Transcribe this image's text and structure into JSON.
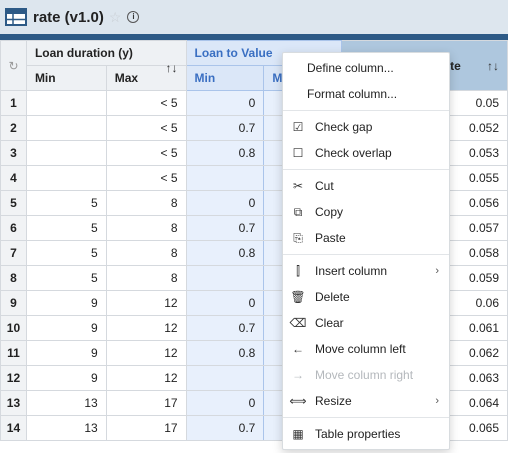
{
  "title": "rate (v1.0)",
  "header": {
    "group1": "Loan duration (y)",
    "group2": "Loan to Value",
    "group3_partial": "te",
    "sub_min": "Min",
    "sub_max": "Max",
    "sub_min2": "Min",
    "sub_max2_partial": "M",
    "sort_icon": "↑↓"
  },
  "rows": [
    {
      "n": "1",
      "min": "",
      "max": "< 5",
      "ltv": "0",
      "rate": "0.05"
    },
    {
      "n": "2",
      "min": "",
      "max": "< 5",
      "ltv": "0.7",
      "rate": "0.052"
    },
    {
      "n": "3",
      "min": "",
      "max": "< 5",
      "ltv": "0.8",
      "rate": "0.053"
    },
    {
      "n": "4",
      "min": "",
      "max": "< 5",
      "ltv": "",
      "rate": "0.055"
    },
    {
      "n": "5",
      "min": "5",
      "max": "8",
      "ltv": "0",
      "rate": "0.056"
    },
    {
      "n": "6",
      "min": "5",
      "max": "8",
      "ltv": "0.7",
      "rate": "0.057"
    },
    {
      "n": "7",
      "min": "5",
      "max": "8",
      "ltv": "0.8",
      "rate": "0.058"
    },
    {
      "n": "8",
      "min": "5",
      "max": "8",
      "ltv": "",
      "rate": "0.059"
    },
    {
      "n": "9",
      "min": "9",
      "max": "12",
      "ltv": "0",
      "rate": "0.06"
    },
    {
      "n": "10",
      "min": "9",
      "max": "12",
      "ltv": "0.7",
      "rate": "0.061"
    },
    {
      "n": "11",
      "min": "9",
      "max": "12",
      "ltv": "0.8",
      "rate": "0.062"
    },
    {
      "n": "12",
      "min": "9",
      "max": "12",
      "ltv": "",
      "rate": "0.063"
    },
    {
      "n": "13",
      "min": "13",
      "max": "17",
      "ltv": "0",
      "rate": "0.064"
    },
    {
      "n": "14",
      "min": "13",
      "max": "17",
      "ltv": "0.7",
      "rate": "0.065"
    }
  ],
  "menu": {
    "define_column": "Define column...",
    "format_column": "Format column...",
    "check_gap": "Check gap",
    "check_overlap": "Check overlap",
    "cut": "Cut",
    "copy": "Copy",
    "paste": "Paste",
    "insert_column": "Insert column",
    "delete": "Delete",
    "clear": "Clear",
    "move_left": "Move column left",
    "move_right": "Move column right",
    "resize": "Resize",
    "table_properties": "Table properties"
  },
  "colors": {
    "accent": "#2d5a86",
    "selected_column": "#e8f0fc",
    "header_selected_text": "#3a6fc2"
  }
}
